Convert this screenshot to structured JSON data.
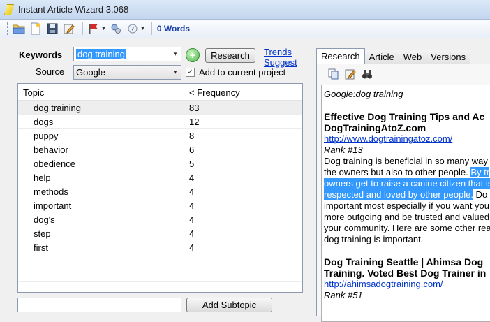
{
  "window": {
    "title": "Instant Article Wizard 3.068"
  },
  "toolbar": {
    "word_count": "0 Words"
  },
  "keywords": {
    "label": "Keywords",
    "value": "dog training",
    "research_button": "Research",
    "trends_link": "Trends",
    "suggest_link": "Suggest"
  },
  "source": {
    "label": "Source",
    "value": "Google",
    "add_to_project_label": "Add to current project",
    "add_to_project_checked": true
  },
  "topic_table": {
    "headers": {
      "topic": "Topic",
      "frequency": "< Frequency"
    },
    "rows": [
      {
        "topic": "dog training",
        "frequency": "83"
      },
      {
        "topic": "dogs",
        "frequency": "12"
      },
      {
        "topic": "puppy",
        "frequency": "8"
      },
      {
        "topic": "behavior",
        "frequency": "6"
      },
      {
        "topic": "obedience",
        "frequency": "5"
      },
      {
        "topic": "help",
        "frequency": "4"
      },
      {
        "topic": "methods",
        "frequency": "4"
      },
      {
        "topic": "important",
        "frequency": "4"
      },
      {
        "topic": "dog's",
        "frequency": "4"
      },
      {
        "topic": "step",
        "frequency": "4"
      },
      {
        "topic": "first",
        "frequency": "4"
      }
    ]
  },
  "subtopic": {
    "input_value": "",
    "button": "Add Subtopic"
  },
  "tabs": [
    {
      "label": "Research",
      "active": true
    },
    {
      "label": "Article",
      "active": false
    },
    {
      "label": "Web",
      "active": false
    },
    {
      "label": "Versions",
      "active": false
    }
  ],
  "research": {
    "query": "Google:dog training",
    "results": [
      {
        "title_line1": "Effective Dog Training Tips and Ac",
        "title_line2": "DogTrainingAtoZ.com",
        "url": "http://www.dogtrainingatoz.com/",
        "rank": "Rank #13",
        "snippet": [
          {
            "text": "Dog training is beneficial in so many way",
            "sel": "",
            "after": ""
          },
          {
            "text": "the owners but also to other people. ",
            "sel": "By tr",
            "after": ""
          },
          {
            "text": "",
            "sel": "owners get to raise a canine citizen that is",
            "after": ""
          },
          {
            "text": "",
            "sel": "respected and loved by other people.",
            "after": " Do"
          },
          {
            "text": "important most especially if you want you",
            "sel": "",
            "after": ""
          },
          {
            "text": "more outgoing and be trusted and valued",
            "sel": "",
            "after": ""
          },
          {
            "text": "your community. Here are some other rea",
            "sel": "",
            "after": ""
          },
          {
            "text": "dog training is important.",
            "sel": "",
            "after": ""
          }
        ]
      },
      {
        "title_line1": "Dog Training Seattle | Ahimsa Dog",
        "title_line2": "Training. Voted Best Dog Trainer in",
        "url": "http://ahimsadogtraining.com/",
        "rank": "Rank #51"
      }
    ]
  }
}
